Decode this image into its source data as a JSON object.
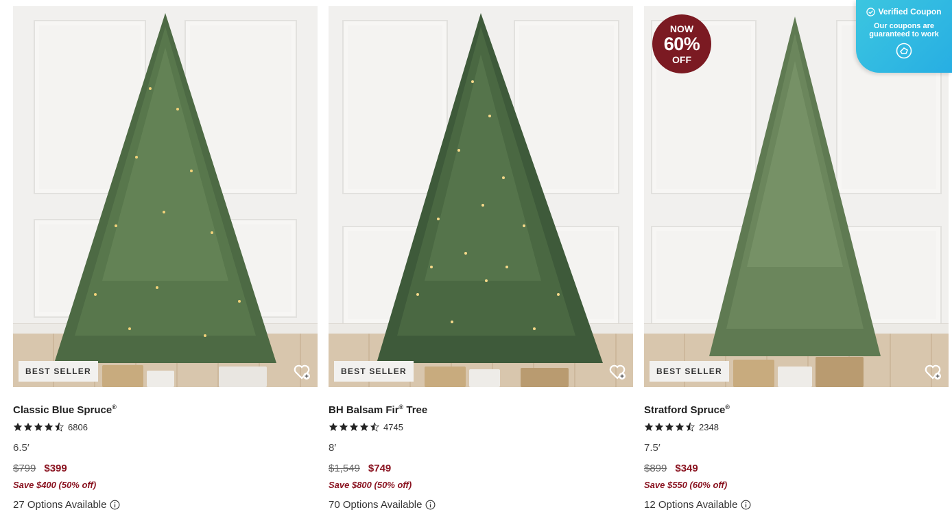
{
  "products": [
    {
      "badge": "BEST SELLER",
      "name": "Classic Blue Spruce",
      "reg": "®",
      "rating_count": "6806",
      "rating": 4.5,
      "size": "6.5′",
      "old_price": "$799",
      "new_price": "$399",
      "save_text": "Save $400 (50% off)",
      "options_text": "27 Options Available"
    },
    {
      "badge": "BEST SELLER",
      "name": "BH Balsam Fir",
      "reg": "®",
      "name_suffix": " Tree",
      "rating_count": "4745",
      "rating": 4.5,
      "size": "8′",
      "old_price": "$1,549",
      "new_price": "$749",
      "save_text": "Save $800 (50% off)",
      "options_text": "70 Options Available"
    },
    {
      "badge": "BEST SELLER",
      "name": "Stratford Spruce",
      "reg": "®",
      "rating_count": "2348",
      "rating": 4.5,
      "size": "7.5′",
      "old_price": "$899",
      "new_price": "$349",
      "save_text": "Save $550 (60% off)",
      "options_text": "12 Options Available",
      "sale": {
        "line1": "NOW",
        "line2": "60%",
        "line3": "OFF"
      }
    }
  ],
  "coupon": {
    "title": "Verified Coupon",
    "text": "Our coupons are guaranteed to work"
  },
  "colors": {
    "sale_red": "#8a1320",
    "sale_circle": "#7b1a22",
    "coupon_blue": "#27aee3"
  },
  "icons": [
    "heart-plus-icon",
    "star-icon",
    "info-icon",
    "check-circle-icon",
    "coupon-logo-icon"
  ]
}
